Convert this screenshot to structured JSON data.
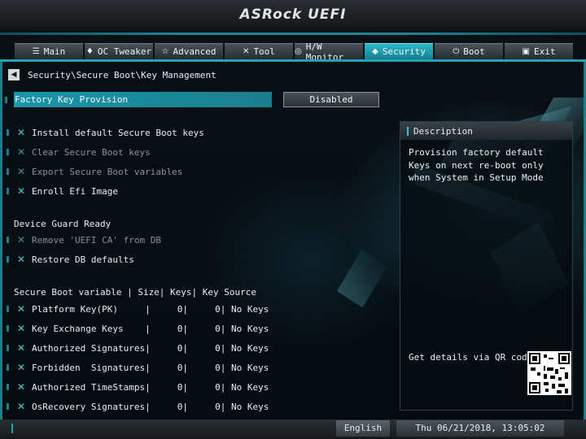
{
  "header": {
    "brand": "ASRock UEFI"
  },
  "tabs": [
    {
      "label": "Main",
      "icon": "☰"
    },
    {
      "label": "OC Tweaker",
      "icon": "♦"
    },
    {
      "label": "Advanced",
      "icon": "☆"
    },
    {
      "label": "Tool",
      "icon": "✕"
    },
    {
      "label": "H/W Monitor",
      "icon": "◎"
    },
    {
      "label": "Security",
      "icon": "◆"
    },
    {
      "label": "Boot",
      "icon": "⏻"
    },
    {
      "label": "Exit",
      "icon": "▣"
    }
  ],
  "active_tab": "Security",
  "breadcrumb": "Security\\Secure Boot\\Key Management",
  "setting": {
    "label": "Factory Key Provision",
    "value": "Disabled"
  },
  "actions": [
    {
      "label": "Install default Secure Boot keys",
      "enabled": true
    },
    {
      "label": "Clear Secure Boot keys",
      "enabled": false
    },
    {
      "label": "Export Secure Boot variables",
      "enabled": false
    },
    {
      "label": "Enroll Efi Image",
      "enabled": true
    }
  ],
  "device_guard": {
    "title": "Device Guard Ready",
    "items": [
      {
        "label": "Remove 'UEFI CA' from DB",
        "enabled": false
      },
      {
        "label": "Restore DB defaults",
        "enabled": true
      }
    ]
  },
  "variables_header": "Secure Boot variable | Size| Keys| Key Source",
  "variables": [
    "Platform Key(PK)     |     0|     0| No Keys",
    "Key Exchange Keys    |     0|     0| No Keys",
    "Authorized Signatures|     0|     0| No Keys",
    "Forbidden  Signatures|     0|     0| No Keys",
    "Authorized TimeStamps|     0|     0| No Keys",
    "OsRecovery Signatures|     0|     0| No Keys"
  ],
  "description": {
    "title": "Description",
    "text": "Provision factory default Keys on next re-boot only when System in Setup Mode",
    "qr_label": "Get details via QR code"
  },
  "footer": {
    "language": "English",
    "datetime": "Thu 06/21/2018, 13:05:02"
  },
  "colors": {
    "accent": "#1fa5b6",
    "active_tab": "#2bb8ca",
    "selection": "#1896a8"
  }
}
